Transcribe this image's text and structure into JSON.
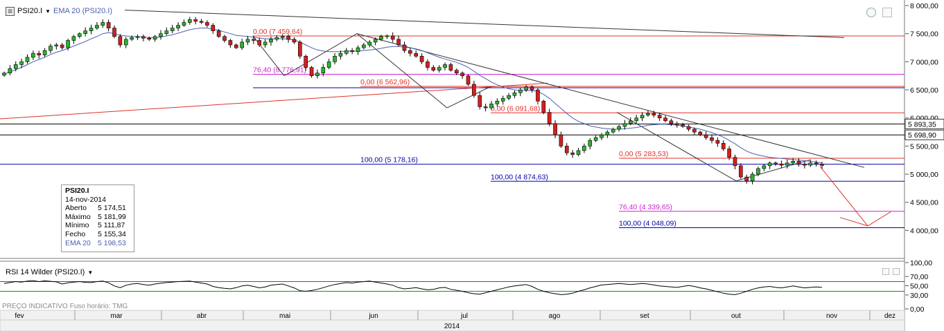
{
  "toolbar": {
    "symbol": "PSI20.I",
    "ema_label": "EMA 20 (PSI20.I)",
    "rsi_label": "RSI 14 Wilder (PSI20.I)",
    "dropdown_glyph": "▼"
  },
  "info_box": {
    "title": "PSI20.I",
    "date": "14-nov-2014",
    "rows": [
      {
        "label": "Aberto",
        "value": "5 174,51"
      },
      {
        "label": "Máximo",
        "value": "5 181,99"
      },
      {
        "label": "Mínimo",
        "value": "5 111,87"
      },
      {
        "label": "Fecho",
        "value": "5 155,34"
      },
      {
        "label": "EMA 20",
        "value": "5 198,53"
      }
    ]
  },
  "footer": {
    "text": "PREÇO INDICATIVO    Fuso horário: TMG"
  },
  "colors": {
    "up": "#2db32d",
    "down": "#d22020",
    "ema": "#4a5fb0",
    "red_line": "#e0302a",
    "magenta": "#cc22cc",
    "blue": "#0000aa",
    "grid": "#d0d0d0"
  },
  "chart_data": [
    {
      "type": "candlestick",
      "title": "PSI20.I",
      "year_label": "2014",
      "x_labels": [
        "fev",
        "mar",
        "abr",
        "mai",
        "jun",
        "jul",
        "ago",
        "set",
        "out",
        "nov",
        "dez"
      ],
      "y_ticks": [
        "8 000,00",
        "7 500,00",
        "7 000,00",
        "6 500,00",
        "6 000,00",
        "5 500,00",
        "5 000,00",
        "4 500,00",
        "4 000,00"
      ],
      "y_tick_values": [
        8000,
        7500,
        7000,
        6500,
        6000,
        5500,
        5000,
        4500,
        4000
      ],
      "ylim": [
        3550,
        8050
      ],
      "price_tags": [
        {
          "label": "5 893,35",
          "value": 5893.35
        },
        {
          "label": "5 698,90",
          "value": 5698.9
        }
      ],
      "fib_levels": [
        {
          "label": "0,00 (7 459,64)",
          "value": 7459.64,
          "color": "red"
        },
        {
          "label": "76,40 (6 776,91)",
          "value": 6776.91,
          "color": "magenta"
        },
        {
          "label": "0,00 (6 562,96)",
          "value": 6562.96,
          "color": "red"
        },
        {
          "label": "0,00 (6 091,68)",
          "value": 6091.68,
          "color": "red"
        },
        {
          "label": "0,00 (5 283,53)",
          "value": 5283.53,
          "color": "red"
        },
        {
          "label": "100,00 (5 178,16)",
          "value": 5178.16,
          "color": "blue"
        },
        {
          "label": "100,00 (4 874,63)",
          "value": 4874.63,
          "color": "blue"
        },
        {
          "label": "76,40 (4 339,65)",
          "value": 4339.65,
          "color": "magenta"
        },
        {
          "label": "100,00 (4 048,09)",
          "value": 4048.09,
          "color": "blue"
        }
      ],
      "close_series": [
        6800,
        6880,
        6950,
        7000,
        7080,
        7150,
        7120,
        7200,
        7280,
        7300,
        7250,
        7380,
        7450,
        7500,
        7550,
        7600,
        7650,
        7700,
        7600,
        7450,
        7300,
        7400,
        7430,
        7450,
        7420,
        7400,
        7450,
        7500,
        7550,
        7600,
        7650,
        7700,
        7750,
        7720,
        7700,
        7650,
        7550,
        7450,
        7380,
        7300,
        7250,
        7350,
        7400,
        7380,
        7300,
        7350,
        7400,
        7430,
        7450,
        7400,
        7350,
        7100,
        6900,
        6750,
        6800,
        6900,
        7000,
        7100,
        7150,
        7200,
        7180,
        7250,
        7300,
        7350,
        7400,
        7450,
        7460,
        7400,
        7300,
        7200,
        7150,
        7100,
        7000,
        6900,
        6850,
        6900,
        6950,
        6850,
        6800,
        6750,
        6600,
        6400,
        6200,
        6180,
        6250,
        6300,
        6350,
        6400,
        6450,
        6500,
        6550,
        6500,
        6300,
        6100,
        5900,
        5700,
        5500,
        5380,
        5350,
        5420,
        5500,
        5600,
        5650,
        5700,
        5750,
        5800,
        5850,
        5900,
        5950,
        6000,
        6050,
        6080,
        6050,
        6000,
        5950,
        5900,
        5880,
        5850,
        5800,
        5750,
        5700,
        5650,
        5600,
        5550,
        5450,
        5300,
        5150,
        4950,
        4880,
        5000,
        5100,
        5150,
        5200,
        5180,
        5160,
        5200,
        5230,
        5180,
        5160,
        5200,
        5180,
        5155
      ],
      "ema20": [
        6780,
        6820,
        6860,
        6900,
        6950,
        7000,
        7040,
        7080,
        7130,
        7170,
        7200,
        7240,
        7280,
        7320,
        7360,
        7410,
        7450,
        7500,
        7520,
        7500,
        7470,
        7460,
        7450,
        7450,
        7440,
        7430,
        7430,
        7440,
        7460,
        7480,
        7510,
        7540,
        7570,
        7590,
        7600,
        7600,
        7580,
        7560,
        7530,
        7500,
        7470,
        7460,
        7450,
        7440,
        7420,
        7410,
        7410,
        7410,
        7410,
        7400,
        7390,
        7350,
        7300,
        7250,
        7210,
        7190,
        7180,
        7180,
        7180,
        7190,
        7190,
        7190,
        7200,
        7210,
        7220,
        7240,
        7260,
        7270,
        7270,
        7260,
        7250,
        7230,
        7200,
        7160,
        7120,
        7080,
        7050,
        7020,
        6990,
        6950,
        6900,
        6830,
        6760,
        6700,
        6640,
        6590,
        6550,
        6520,
        6500,
        6490,
        6490,
        6490,
        6470,
        6420,
        6350,
        6260,
        6170,
        6080,
        6000,
        5940,
        5900,
        5860,
        5840,
        5820,
        5810,
        5800,
        5800,
        5810,
        5820,
        5830,
        5850,
        5870,
        5880,
        5890,
        5890,
        5880,
        5870,
        5860,
        5840,
        5820,
        5800,
        5770,
        5740,
        5700,
        5660,
        5600,
        5540,
        5470,
        5410,
        5370,
        5340,
        5320,
        5300,
        5290,
        5280,
        5270,
        5260,
        5250,
        5240,
        5230,
        5215,
        5198.53
      ],
      "rsi": {
        "name": "RSI 14 Wilder",
        "y_ticks": [
          "100,00",
          "70,00",
          "50,00",
          "30,00",
          "0,00"
        ],
        "levels": [
          70,
          30
        ],
        "ylim": [
          0,
          100
        ],
        "values": [
          62,
          66,
          70,
          68,
          72,
          74,
          70,
          73,
          71,
          69,
          60,
          65,
          68,
          70,
          67,
          66,
          70,
          72,
          65,
          52,
          45,
          55,
          60,
          62,
          58,
          55,
          60,
          63,
          66,
          68,
          70,
          71,
          72,
          68,
          64,
          60,
          50,
          45,
          42,
          40,
          45,
          52,
          55,
          50,
          44,
          48,
          55,
          58,
          60,
          52,
          44,
          32,
          30,
          33,
          38,
          45,
          52,
          58,
          62,
          66,
          64,
          68,
          70,
          72,
          68,
          64,
          60,
          55,
          45,
          40,
          42,
          45,
          40,
          36,
          38,
          44,
          46,
          38,
          34,
          30,
          24,
          20,
          18,
          24,
          30,
          36,
          42,
          48,
          52,
          55,
          58,
          50,
          38,
          30,
          24,
          20,
          16,
          18,
          22,
          30,
          36,
          44,
          50,
          56,
          58,
          60,
          62,
          60,
          58,
          60,
          62,
          60,
          56,
          52,
          50,
          48,
          46,
          50,
          54,
          50,
          44,
          40,
          34,
          28,
          22,
          18,
          16,
          22,
          30,
          38,
          44,
          48,
          50,
          46,
          44,
          48,
          52,
          48,
          44,
          46,
          48,
          46
        ]
      }
    }
  ]
}
